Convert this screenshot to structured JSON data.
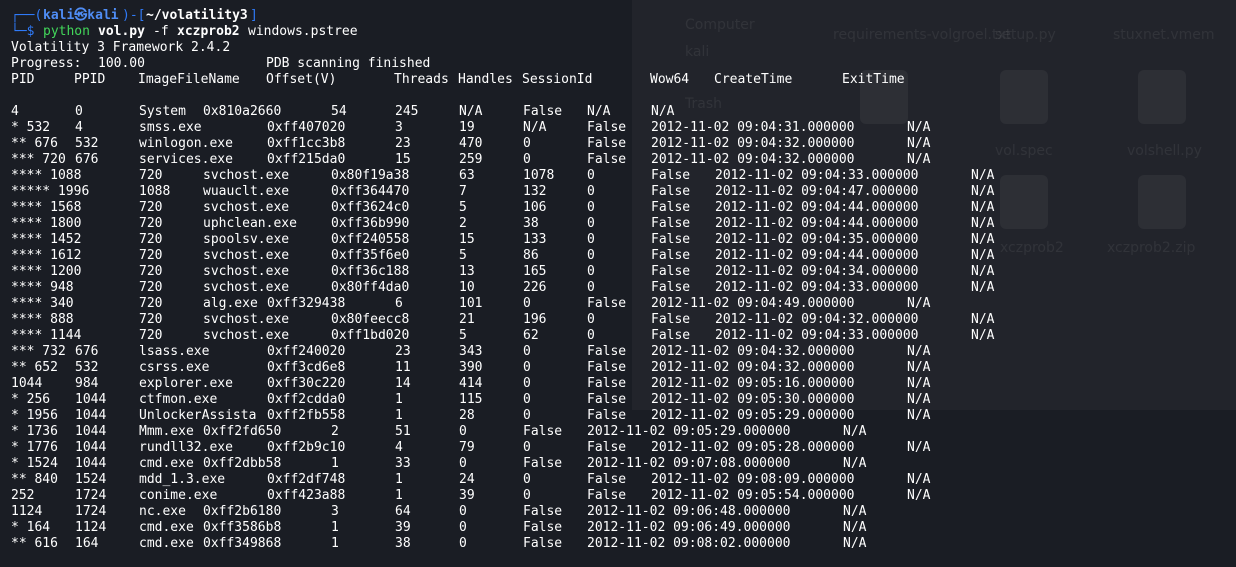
{
  "prompt": {
    "box_top": "┌──(",
    "user": "kali㉿kali",
    "sep": ")-[",
    "dir": "~/volatility3",
    "close": "]",
    "box_bottom": "└─$",
    "command": "python",
    "script": "vol.py",
    "flag": "-f",
    "image": "xczprob2",
    "plugin": "windows.pstree"
  },
  "output": {
    "banner": "Volatility 3 Framework 2.4.2",
    "progress_label": "Progress:",
    "progress_value": "100.00",
    "scan_status": "PDB scanning finished",
    "headers": [
      "PID",
      "PPID",
      "ImageFileName",
      "Offset(V)",
      "Threads",
      "Handles",
      "SessionId",
      "Wow64",
      "CreateTime",
      "ExitTime"
    ]
  },
  "rows": [
    [
      "4",
      "0",
      "System",
      "0x810a2660",
      "54",
      "245",
      "N/A",
      "False",
      "N/A",
      "N/A"
    ],
    [
      "* 532",
      "4",
      "smss.exe",
      "0xff407020",
      "3",
      "19",
      "N/A",
      "False",
      "2012-11-02 09:04:31.000000",
      "N/A"
    ],
    [
      "** 676",
      "532",
      "winlogon.exe",
      "0xff1cc3b8",
      "23",
      "470",
      "0",
      "False",
      "2012-11-02 09:04:32.000000",
      "N/A"
    ],
    [
      "*** 720",
      "676",
      "services.exe",
      "0xff215da0",
      "15",
      "259",
      "0",
      "False",
      "2012-11-02 09:04:32.000000",
      "N/A"
    ],
    [
      "**** 1088",
      "720",
      "svchost.exe",
      "0x80f19a38",
      "63",
      "1078",
      "0",
      "False",
      "2012-11-02 09:04:33.000000",
      "N/A"
    ],
    [
      "***** 1996",
      "1088",
      "wuauclt.exe",
      "0xff364470",
      "7",
      "132",
      "0",
      "False",
      "2012-11-02 09:04:47.000000",
      "N/A"
    ],
    [
      "**** 1568",
      "720",
      "svchost.exe",
      "0xff3624c0",
      "5",
      "106",
      "0",
      "False",
      "2012-11-02 09:04:44.000000",
      "N/A"
    ],
    [
      "**** 1800",
      "720",
      "uphclean.exe",
      "0xff36b990",
      "2",
      "38",
      "0",
      "False",
      "2012-11-02 09:04:44.000000",
      "N/A"
    ],
    [
      "**** 1452",
      "720",
      "spoolsv.exe",
      "0xff240558",
      "15",
      "133",
      "0",
      "False",
      "2012-11-02 09:04:35.000000",
      "N/A"
    ],
    [
      "**** 1612",
      "720",
      "svchost.exe",
      "0xff35f6e0",
      "5",
      "86",
      "0",
      "False",
      "2012-11-02 09:04:44.000000",
      "N/A"
    ],
    [
      "**** 1200",
      "720",
      "svchost.exe",
      "0xff36c188",
      "13",
      "165",
      "0",
      "False",
      "2012-11-02 09:04:34.000000",
      "N/A"
    ],
    [
      "**** 948",
      "720",
      "svchost.exe",
      "0x80ff4da0",
      "10",
      "226",
      "0",
      "False",
      "2012-11-02 09:04:33.000000",
      "N/A"
    ],
    [
      "**** 340",
      "720",
      "alg.exe",
      "0xff329438",
      "6",
      "101",
      "0",
      "False",
      "2012-11-02 09:04:49.000000",
      "N/A"
    ],
    [
      "**** 888",
      "720",
      "svchost.exe",
      "0x80feecc8",
      "21",
      "196",
      "0",
      "False",
      "2012-11-02 09:04:32.000000",
      "N/A"
    ],
    [
      "**** 1144",
      "720",
      "svchost.exe",
      "0xff1bd020",
      "5",
      "62",
      "0",
      "False",
      "2012-11-02 09:04:33.000000",
      "N/A"
    ],
    [
      "*** 732",
      "676",
      "lsass.exe",
      "0xff240020",
      "23",
      "343",
      "0",
      "False",
      "2012-11-02 09:04:32.000000",
      "N/A"
    ],
    [
      "** 652",
      "532",
      "csrss.exe",
      "0xff3cd6e8",
      "11",
      "390",
      "0",
      "False",
      "2012-11-02 09:04:32.000000",
      "N/A"
    ],
    [
      "1044",
      "984",
      "explorer.exe",
      "0xff30c220",
      "14",
      "414",
      "0",
      "False",
      "2012-11-02 09:05:16.000000",
      "N/A"
    ],
    [
      "* 256",
      "1044",
      "ctfmon.exe",
      "0xff2cdda0",
      "1",
      "115",
      "0",
      "False",
      "2012-11-02 09:05:30.000000",
      "N/A"
    ],
    [
      "* 1956",
      "1044",
      "UnlockerAssista",
      "0xff2fb558",
      "1",
      "28",
      "0",
      "False",
      "2012-11-02 09:05:29.000000",
      "N/A"
    ],
    [
      "* 1736",
      "1044",
      "Mmm.exe",
      "0xff2fd650",
      "2",
      "51",
      "0",
      "False",
      "2012-11-02 09:05:29.000000",
      "N/A"
    ],
    [
      "* 1776",
      "1044",
      "rundll32.exe",
      "0xff2b9c10",
      "4",
      "79",
      "0",
      "False",
      "2012-11-02 09:05:28.000000",
      "N/A"
    ],
    [
      "* 1524",
      "1044",
      "cmd.exe",
      "0xff2dbb58",
      "1",
      "33",
      "0",
      "False",
      "2012-11-02 09:07:08.000000",
      "N/A"
    ],
    [
      "** 840",
      "1524",
      "mdd_1.3.exe",
      "0xff2df748",
      "1",
      "24",
      "0",
      "False",
      "2012-11-02 09:08:09.000000",
      "N/A"
    ],
    [
      "252",
      "1724",
      "conime.exe",
      "0xff423a88",
      "1",
      "39",
      "0",
      "False",
      "2012-11-02 09:05:54.000000",
      "N/A"
    ],
    [
      "1124",
      "1724",
      "nc.exe",
      "0xff2b6180",
      "3",
      "64",
      "0",
      "False",
      "2012-11-02 09:06:48.000000",
      "N/A"
    ],
    [
      "* 164",
      "1124",
      "cmd.exe",
      "0xff3586b8",
      "1",
      "39",
      "0",
      "False",
      "2012-11-02 09:06:49.000000",
      "N/A"
    ],
    [
      "** 616",
      "164",
      "cmd.exe",
      "0xff349868",
      "1",
      "38",
      "0",
      "False",
      "2012-11-02 09:08:02.000000",
      "N/A"
    ]
  ],
  "desktop_labels": [
    "Computer",
    "kali",
    "Trash",
    "requirements-volgroel.txt",
    "setup.py",
    "stuxnet.vmem",
    "vol.spec",
    "volshell.py",
    "xczprob2",
    "xczprob2.zip"
  ]
}
